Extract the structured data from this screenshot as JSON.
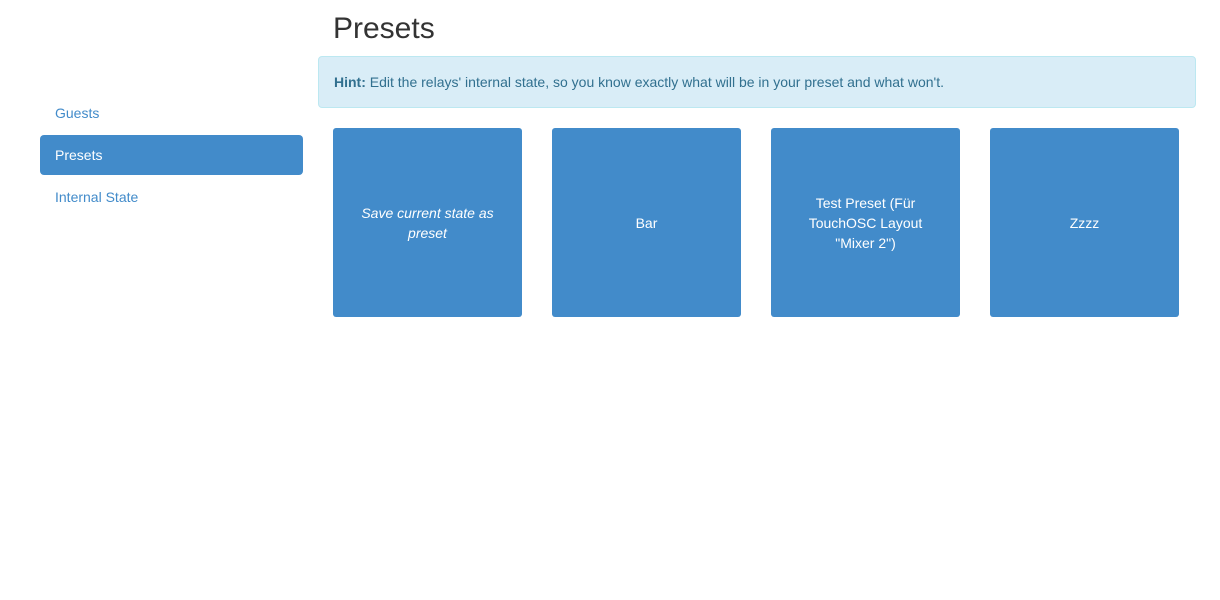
{
  "page": {
    "title": "Presets"
  },
  "sidebar": {
    "items": [
      {
        "label": "Guests",
        "active": false
      },
      {
        "label": "Presets",
        "active": true
      },
      {
        "label": "Internal State",
        "active": false
      }
    ]
  },
  "hint": {
    "label": "Hint:",
    "text": "Edit the relays' internal state, so you know exactly what will be in your preset and what won't."
  },
  "presets": {
    "save_label": "Save current state as preset",
    "items": [
      {
        "label": "Bar"
      },
      {
        "label": "Test Preset (Für TouchOSC Layout \"Mixer 2\")"
      },
      {
        "label": "Zzzz"
      }
    ]
  },
  "colors": {
    "accent": "#428bca",
    "hint_background": "#d9edf7",
    "hint_text": "#31708f"
  }
}
